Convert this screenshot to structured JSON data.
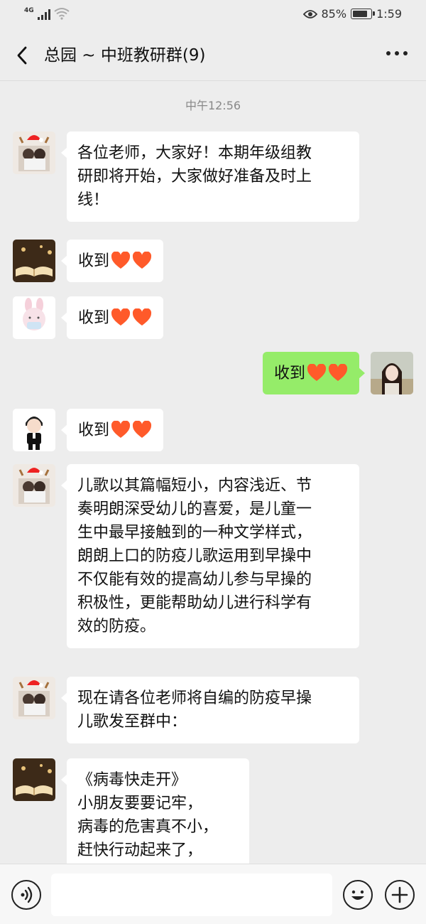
{
  "status_bar": {
    "network": "4G",
    "battery": "85%",
    "battery_level": 0.85,
    "time": "1:59",
    "icons": [
      "signal-icon",
      "wifi-icon",
      "eye-icon",
      "battery-icon"
    ]
  },
  "header": {
    "title": "总园 ~ 中班教研群(9)",
    "back_icon": "back-chevron-icon",
    "more_icon": "more-dots-icon"
  },
  "chat": {
    "timestamp": "中午12:56",
    "messages": [
      {
        "side": "left",
        "avatar": "avatar-couple-christmas",
        "text": [
          "各位老师，大家好！本期年级组教",
          "研即将开始，大家做好准备及时上",
          "线！"
        ]
      },
      {
        "side": "left",
        "avatar": "avatar-book",
        "text": [
          "收到"
        ],
        "hearts": 2
      },
      {
        "side": "left",
        "avatar": "avatar-bunny",
        "text": [
          "收到"
        ],
        "hearts": 2
      },
      {
        "side": "right",
        "avatar": "avatar-girl",
        "text": [
          "收到"
        ],
        "hearts": 2
      },
      {
        "side": "left",
        "avatar": "avatar-cartoon-boy",
        "text": [
          "收到"
        ],
        "hearts": 2
      },
      {
        "side": "left",
        "avatar": "avatar-couple-christmas",
        "text": [
          "儿歌以其篇幅短小，内容浅近、节",
          "奏明朗深受幼儿的喜爱，是儿童一",
          "生中最早接触到的一种文学样式，",
          "朗朗上口的防疫儿歌运用到早操中",
          "不仅能有效的提高幼儿参与早操的",
          "积极性，更能帮助幼儿进行科学有",
          "效的防疫。"
        ]
      },
      {
        "side": "left",
        "avatar": "avatar-couple-christmas",
        "text": [
          "现在请各位老师将自编的防疫早操",
          "儿歌发至群中："
        ]
      },
      {
        "side": "left",
        "avatar": "avatar-book",
        "text": [
          "《病毒快走开》",
          "小朋友要要记牢，",
          "病毒的危害真不小，",
          "赶快行动起来了，"
        ]
      }
    ]
  },
  "input_bar": {
    "voice_icon": "voice-icon",
    "emoji_icon": "emoji-icon",
    "plus_icon": "plus-icon"
  },
  "colors": {
    "background": "#ededed",
    "bubble_self": "#95ec69",
    "bubble_other": "#ffffff",
    "heart": "#ff5a2a"
  }
}
